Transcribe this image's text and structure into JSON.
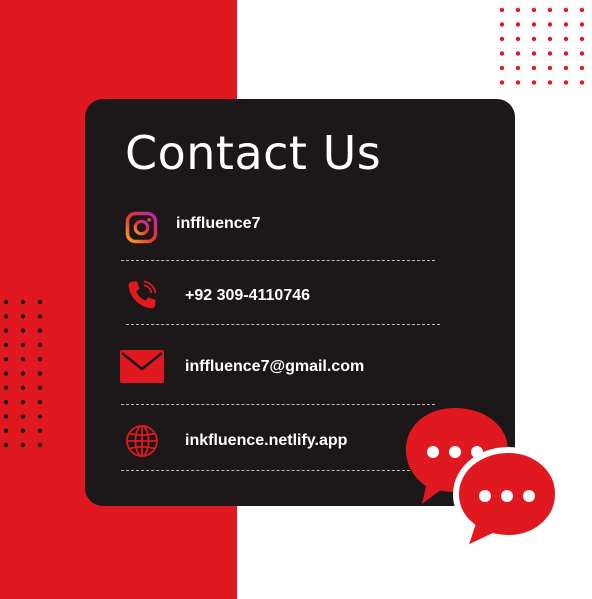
{
  "heading": "Contact Us",
  "contacts": [
    {
      "icon": "instagram-icon",
      "text": "inffluence7"
    },
    {
      "icon": "phone-icon",
      "text": "+92 309-4110746"
    },
    {
      "icon": "mail-icon",
      "text": "inffluence7@gmail.com"
    },
    {
      "icon": "globe-icon",
      "text": "inkfluence.netlify.app"
    }
  ],
  "colors": {
    "accent": "#e0181f",
    "card": "#1c1819",
    "text": "#ffffff"
  },
  "decor": {
    "chat_bubbles_icon": "chat-bubbles-icon"
  }
}
